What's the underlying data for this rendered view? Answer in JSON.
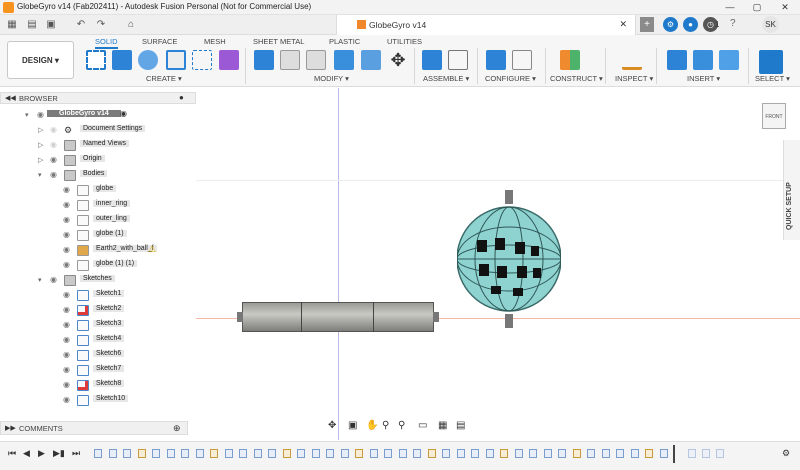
{
  "window": {
    "title": "GlobeGyro v14 (Fab202411) - Autodesk Fusion Personal (Not for Commercial Use)",
    "min": "—",
    "max": "▢",
    "close": "✕"
  },
  "doc_tab": {
    "title": "GlobeGyro v14",
    "close": "✕"
  },
  "header": {
    "jobs_count": "1",
    "user_initials": "SK",
    "add": "+"
  },
  "workspace": "DESIGN",
  "ribbon_tabs": [
    "SOLID",
    "SURFACE",
    "MESH",
    "SHEET METAL",
    "PLASTIC",
    "UTILITIES"
  ],
  "tool_groups": [
    "CREATE",
    "MODIFY",
    "ASSEMBLE",
    "CONFIGURE",
    "CONSTRUCT",
    "INSPECT",
    "INSERT",
    "SELECT"
  ],
  "browser": {
    "title": "BROWSER",
    "root": "GlobeGyro v14",
    "items": [
      "Document Settings",
      "Named Views",
      "Origin",
      "Bodies"
    ],
    "bodies": [
      "globe",
      "inner_ring",
      "outer_ling",
      "globe (1)",
      "Earth2_with_ball_f",
      "globe (1) (1)"
    ],
    "sketches_label": "Sketches",
    "sketches": [
      "Sketch1",
      "Sketch2",
      "Sketch3",
      "Sketch4",
      "Sketch6",
      "Sketch7",
      "Sketch8",
      "Sketch10"
    ]
  },
  "comments": "COMMENTS",
  "quick_setup": "QUICK SETUP",
  "viewcube": "FRONT",
  "colors": {
    "accent": "#1f7acb",
    "globe": "#8fd3d0",
    "body": "#b3b3ae"
  }
}
